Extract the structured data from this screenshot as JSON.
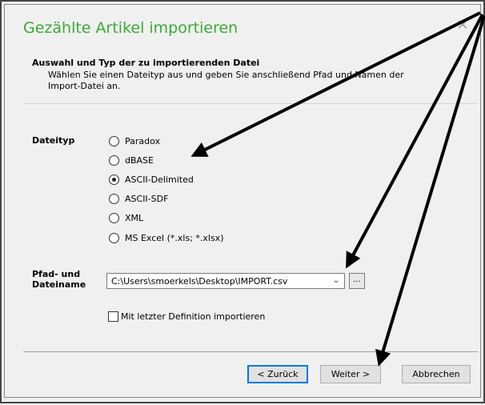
{
  "dialog": {
    "title": "Gezählte Artikel importieren",
    "close_glyph": "✕"
  },
  "section": {
    "title": "Auswahl und Typ der zu importierenden Datei",
    "description": "Wählen Sie einen Dateityp aus und geben Sie anschließend Pfad und Namen der Import-Datei an."
  },
  "filetype": {
    "label": "Dateityp",
    "options": [
      {
        "label": "Paradox",
        "checked": false
      },
      {
        "label": "dBASE",
        "checked": false
      },
      {
        "label": "ASCII-Delimited",
        "checked": true
      },
      {
        "label": "ASCII-SDF",
        "checked": false
      },
      {
        "label": "XML",
        "checked": false
      },
      {
        "label": "MS Excel (*.xls; *.xlsx)",
        "checked": false
      }
    ]
  },
  "path": {
    "label_line1": "Pfad- und",
    "label_line2": "Dateiname",
    "value": "C:\\Users\\smoerkels\\Desktop\\IMPORT.csv",
    "browse_label": "..."
  },
  "options": {
    "last_definition_label": "Mit letzter Definition importieren",
    "last_definition_checked": false
  },
  "buttons": {
    "back": "< Zurück",
    "next": "Weiter >",
    "cancel": "Abbrechen"
  },
  "colors": {
    "title": "#3ea83a",
    "annotation_arrow": "#000000"
  },
  "annotation": {
    "type": "arrows",
    "targets": [
      "dBASE",
      "browse-button",
      "next-button"
    ]
  }
}
